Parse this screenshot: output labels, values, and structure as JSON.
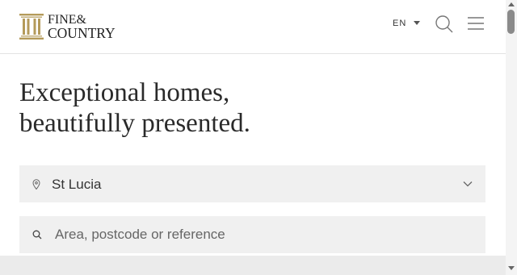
{
  "brand": {
    "line1": "FINE&",
    "line2": "COUNTRY",
    "gold": "#b49a5a"
  },
  "header": {
    "language": "EN",
    "search_icon": "search-icon",
    "menu_icon": "hamburger-menu-icon"
  },
  "hero": {
    "headline_line1": "Exceptional homes,",
    "headline_line2": "beautifully presented."
  },
  "location_select": {
    "selected": "St Lucia",
    "icon": "map-pin-icon"
  },
  "search": {
    "placeholder": "Area, postcode or reference",
    "value": ""
  }
}
